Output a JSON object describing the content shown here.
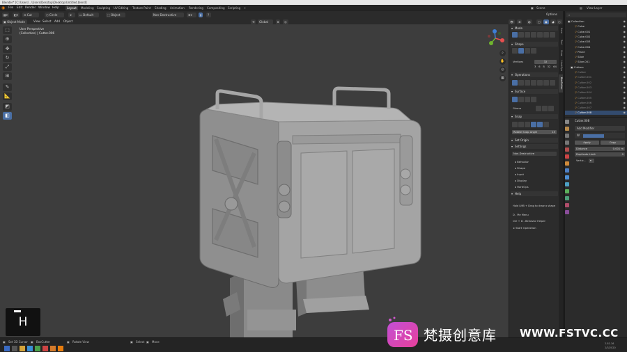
{
  "window": {
    "title": "Blender* [C:\\Users\\...\\Users\\Desktop\\Desktop\\Untitled.blend]"
  },
  "topbar": {
    "menus": [
      "File",
      "Edit",
      "Render",
      "Window",
      "Help"
    ],
    "workspaces": [
      "Layout",
      "Modeling",
      "Sculpting",
      "UV Editing",
      "Texture Paint",
      "Shading",
      "Animation",
      "Rendering",
      "Compositing",
      "Scripting"
    ],
    "active_workspace": "Layout",
    "scene_label": "Scene",
    "view_layer_label": "View Layer"
  },
  "header": {
    "mode": "Object Mode",
    "view_menus": [
      "View",
      "Select",
      "Add",
      "Object"
    ],
    "tool_cut": "Cut",
    "tool_circle": "Circle",
    "tool_default": "Default",
    "tool_object": "Object",
    "tool_nondestructive": "Non-Destructive",
    "orientation": "Global",
    "options": "Options"
  },
  "viewport": {
    "perspective": "User Perspective",
    "collection_label": "(Collection) | Cutter.006"
  },
  "npanel": {
    "tabs": [
      "Item",
      "Tool",
      "View",
      "HardOps",
      "BoxCutter"
    ],
    "sections": {
      "mode": "Mode",
      "shape": "Shape",
      "vertices_label": "Vertices",
      "vertices_value": "32",
      "vertex_presets": [
        "3",
        "6",
        "8",
        "32",
        "64"
      ],
      "operations": "Operations",
      "surface": "Surface",
      "gizmo": "Gizmo",
      "snap": "Snap",
      "rotate_snap_angle": "Rotate Snap Angle",
      "rotate_snap_value": "15",
      "set_origin": "Set Origin",
      "settings": "Settings",
      "nondestructive": "Non-Destructive",
      "subs": [
        "Behavior",
        "Shape",
        "Input",
        "Display",
        "HardOps"
      ],
      "help": "Help",
      "help_line1": "Hold LMB + Drag to draw a shape",
      "help_line2": "D - Pie Menu",
      "help_line3": "Ctrl + D - Behavior Helper",
      "start_operation": "Start Operation"
    }
  },
  "outliner": {
    "rows": [
      {
        "name": "Collection",
        "dim": false,
        "sel": false
      },
      {
        "name": "Cube",
        "dim": false,
        "sel": false
      },
      {
        "name": "Cube.001",
        "dim": false,
        "sel": false
      },
      {
        "name": "Cube.002",
        "dim": false,
        "sel": false
      },
      {
        "name": "Cube.003",
        "dim": false,
        "sel": false
      },
      {
        "name": "Cube.004",
        "dim": false,
        "sel": false
      },
      {
        "name": "Plane",
        "dim": false,
        "sel": false
      },
      {
        "name": "Slice",
        "dim": false,
        "sel": false
      },
      {
        "name": "Slice.001",
        "dim": false,
        "sel": false
      },
      {
        "name": "Cutters",
        "dim": false,
        "sel": false
      },
      {
        "name": "Cutter",
        "dim": true,
        "sel": false
      },
      {
        "name": "Cutter.001",
        "dim": true,
        "sel": false
      },
      {
        "name": "Cutter.002",
        "dim": true,
        "sel": false
      },
      {
        "name": "Cutter.003",
        "dim": true,
        "sel": false
      },
      {
        "name": "Cutter.004",
        "dim": true,
        "sel": false
      },
      {
        "name": "Cutter.005",
        "dim": true,
        "sel": false
      },
      {
        "name": "Cutter.006",
        "dim": true,
        "sel": false
      },
      {
        "name": "Cutter.007",
        "dim": true,
        "sel": false
      },
      {
        "name": "Cutter.008",
        "dim": false,
        "sel": true
      }
    ]
  },
  "properties": {
    "object_name": "Cutter.008",
    "add_modifier": "Add Modifier",
    "modifier_initial": "W",
    "apply": "Apply",
    "copy": "Copy",
    "distance_label": "Distance",
    "distance_value": "0.001 m",
    "duplicate_limit": "Duplicate Limit",
    "duplicate_value": "0",
    "vertex_label": "Vertic..."
  },
  "status": {
    "item1": "Set 3D Cursor",
    "item2": "BoxCutter",
    "item3": "Rotate View",
    "item4": "Select",
    "item5": "Move",
    "version": "2.81.16",
    "time": "2/3/2020"
  },
  "overlay": {
    "key": "H"
  },
  "watermark": {
    "brand": "梵摄创意库",
    "url": "WWW.FSTVC.CC",
    "logo_text": "FS"
  }
}
